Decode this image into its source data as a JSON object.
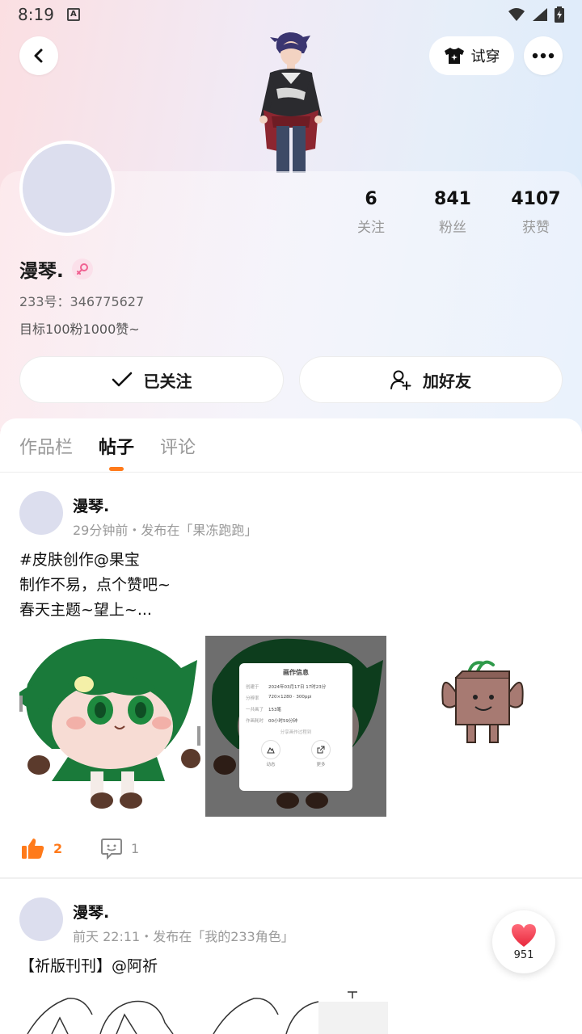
{
  "status": {
    "time": "8:19",
    "a_badge": "A"
  },
  "header": {
    "tryon_label": "试穿"
  },
  "profile": {
    "stats": [
      {
        "num": "6",
        "label": "关注"
      },
      {
        "num": "841",
        "label": "粉丝"
      },
      {
        "num": "4107",
        "label": "获赞"
      }
    ],
    "username": "漫琴.",
    "uid_text": "233号：346775627",
    "bio": "目标100粉1000赞~",
    "followed_label": "已关注",
    "add_friend_label": "加好友"
  },
  "tabs": [
    {
      "label": "作品栏",
      "active": false
    },
    {
      "label": "帖子",
      "active": true
    },
    {
      "label": "评论",
      "active": false
    }
  ],
  "posts": [
    {
      "author": "漫琴.",
      "meta": "29分钟前・发布在「果冻跑跑」",
      "lines": [
        "#皮肤创作@果宝",
        "制作不易，点个赞吧~",
        "春天主题~望上~..."
      ],
      "likes": "2",
      "comments": "1",
      "dialog": {
        "title": "画作信息",
        "rows": [
          [
            "创建于",
            "2024年03月17日 17时23分"
          ],
          [
            "分辨率",
            "720×1280 · 300ppi"
          ],
          [
            "一共画了",
            "153笔"
          ],
          [
            "作画耗时",
            "00小时59分钟"
          ]
        ],
        "hint": "分享画作过程到",
        "btn_a": "动态",
        "btn_b": "更多"
      }
    },
    {
      "author": "漫琴.",
      "meta": "前天 22:11・发布在「我的233角色」",
      "lines": [
        "【祈版刊刊】@阿祈"
      ]
    }
  ],
  "float_like": {
    "count": "951"
  },
  "colors": {
    "accent": "#ff7a1a",
    "avatar_placeholder": "#dcdeee"
  }
}
